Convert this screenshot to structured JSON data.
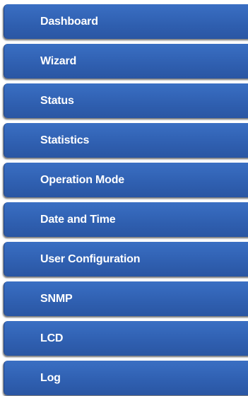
{
  "sidebar": {
    "accent_color": "#2f5fb0",
    "items": [
      {
        "label": "Dashboard"
      },
      {
        "label": "Wizard"
      },
      {
        "label": "Status"
      },
      {
        "label": "Statistics"
      },
      {
        "label": "Operation Mode"
      },
      {
        "label": "Date and Time"
      },
      {
        "label": "User Configuration"
      },
      {
        "label": "SNMP"
      },
      {
        "label": "LCD"
      },
      {
        "label": "Log"
      }
    ]
  }
}
